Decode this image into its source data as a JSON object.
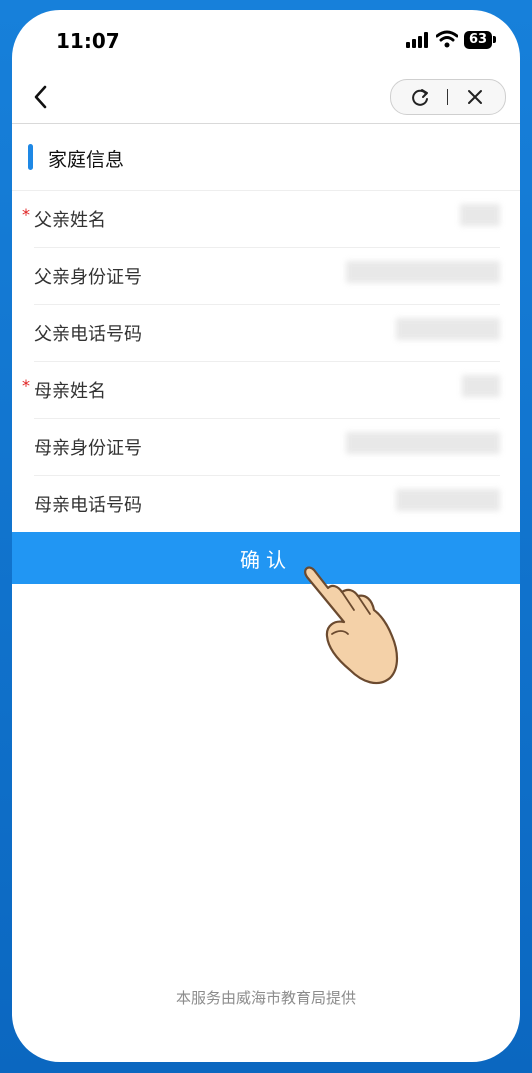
{
  "status_bar": {
    "time": "11:07",
    "battery": "63"
  },
  "nav": {
    "back_icon": "chevron-left-icon",
    "refresh_icon": "refresh-icon",
    "close_icon": "close-icon"
  },
  "section": {
    "title": "家庭信息",
    "accent_color": "#1e88e5"
  },
  "fields": [
    {
      "label": "父亲姓名",
      "required": true,
      "value": ""
    },
    {
      "label": "父亲身份证号",
      "required": false,
      "value": ""
    },
    {
      "label": "父亲电话号码",
      "required": false,
      "value": ""
    },
    {
      "label": "母亲姓名",
      "required": true,
      "value": ""
    },
    {
      "label": "母亲身份证号",
      "required": false,
      "value": ""
    },
    {
      "label": "母亲电话号码",
      "required": false,
      "value": ""
    }
  ],
  "confirm_button": {
    "label": "确认",
    "color": "#2196f3"
  },
  "footer": {
    "text": "本服务由威海市教育局提供"
  }
}
